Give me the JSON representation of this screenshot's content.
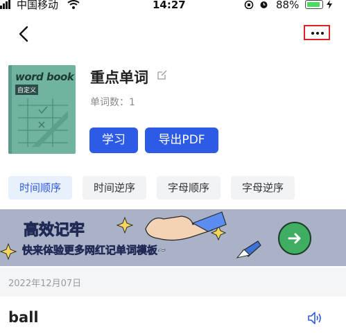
{
  "status_bar": {
    "carrier": "中国移动",
    "time": "14:27",
    "battery": "88%"
  },
  "nav": {
    "back_icon": "chevron-left-icon",
    "more_icon": "more-horizontal-icon"
  },
  "book": {
    "cover_title": "word book",
    "cover_tag": "自定义",
    "color": "#6fb3a0"
  },
  "list": {
    "title": "重点单词",
    "word_count": "单词数：1"
  },
  "actions": {
    "study": "学习",
    "export": "导出PDF"
  },
  "sort_tabs": [
    {
      "label": "时间顺序",
      "active": true
    },
    {
      "label": "时间逆序",
      "active": false
    },
    {
      "label": "字母顺序",
      "active": false
    },
    {
      "label": "字母逆序",
      "active": false
    }
  ],
  "banner": {
    "title": "高效记牢",
    "subtitle": "快来体验更多网红记单词模板~"
  },
  "entries": [
    {
      "date": "2022年12月07日",
      "word": "ball"
    }
  ],
  "colors": {
    "accent": "#2e5be6",
    "highlight_border": "#e02020"
  }
}
